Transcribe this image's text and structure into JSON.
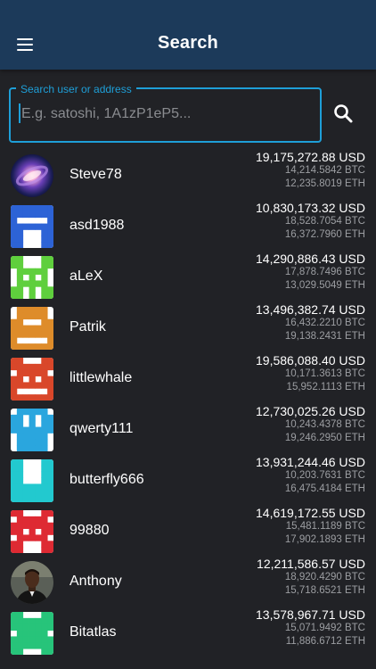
{
  "header": {
    "title": "Search"
  },
  "search": {
    "label": "Search user or address",
    "placeholder": "E.g. satoshi, 1A1zP1eP5..."
  },
  "icons": {
    "menu": "hamburger-menu-icon",
    "search": "magnifier-search-icon"
  },
  "colors": {
    "app_bar": "#1c3a5a",
    "background": "#212226",
    "accent": "#1e9fd8",
    "secondary_text": "#9c9ea2"
  },
  "users": [
    {
      "name": "Steve78",
      "usd": "19,175,272.88 USD",
      "btc": "14,214.5842 BTC",
      "eth": "12,235.8019 ETH",
      "avatar": "galaxy-photo"
    },
    {
      "name": "asd1988",
      "usd": "10,830,173.32 USD",
      "btc": "18,528.7054 BTC",
      "eth": "16,372.7960 ETH",
      "avatar": "pixel-identicon",
      "color": "#2d63d6"
    },
    {
      "name": "aLeX",
      "usd": "14,290,886.43 USD",
      "btc": "17,878.7496 BTC",
      "eth": "13,029.5049 ETH",
      "avatar": "pixel-identicon",
      "color": "#5fcf3d"
    },
    {
      "name": "Patrik",
      "usd": "13,496,382.74 USD",
      "btc": "16,432.2210 BTC",
      "eth": "19,138.2431 ETH",
      "avatar": "pixel-identicon",
      "color": "#de8c2a"
    },
    {
      "name": "littlewhale",
      "usd": "19,586,088.40 USD",
      "btc": "10,171.3613 BTC",
      "eth": "15,952.1113 ETH",
      "avatar": "pixel-identicon",
      "color": "#d9472a"
    },
    {
      "name": "qwerty111",
      "usd": "12,730,025.26 USD",
      "btc": "10,243.4378 BTC",
      "eth": "19,246.2950 ETH",
      "avatar": "pixel-identicon",
      "color": "#2aa6de"
    },
    {
      "name": "butterfly666",
      "usd": "13,931,244.46 USD",
      "btc": "10,203.7631 BTC",
      "eth": "16,475.4184 ETH",
      "avatar": "pixel-identicon",
      "color": "#22c9cf"
    },
    {
      "name": "99880",
      "usd": "14,619,172.55 USD",
      "btc": "15,481.1189 BTC",
      "eth": "17,902.1893 ETH",
      "avatar": "pixel-identicon",
      "color": "#de2a33"
    },
    {
      "name": "Anthony",
      "usd": "12,211,586.57 USD",
      "btc": "18,920.4290 BTC",
      "eth": "15,718.6521 ETH",
      "avatar": "person-photo"
    },
    {
      "name": "Bitatlas",
      "usd": "13,578,967.71 USD",
      "btc": "15,071.9492 BTC",
      "eth": "11,886.6712 ETH",
      "avatar": "pixel-identicon",
      "color": "#27c47a"
    }
  ]
}
